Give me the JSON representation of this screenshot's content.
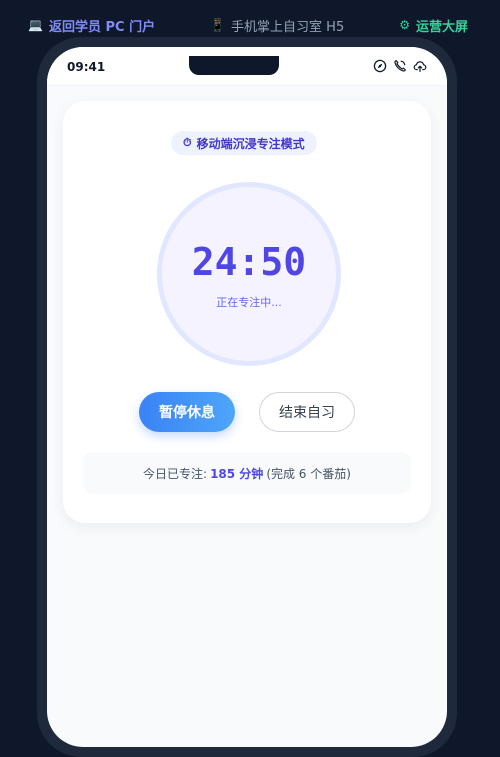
{
  "topnav": {
    "pc_icon": "💻",
    "pc_label": "返回学员 PC 门户",
    "h5_icon": "📱",
    "h5_label": "手机掌上自习室 H5",
    "ops_icon": "⚙",
    "ops_label": "运营大屏"
  },
  "statusbar": {
    "time": "09:41",
    "icons": [
      "compass-icon",
      "phone-icon",
      "cloud-upload-icon"
    ]
  },
  "focus": {
    "mode_icon": "⏱",
    "mode_label": "移动端沉浸专注模式",
    "timer": "24:50",
    "status": "正在专注中..."
  },
  "actions": {
    "pause_label": "暂停休息",
    "end_label": "结束自习"
  },
  "summary": {
    "prefix": "今日已专注:",
    "minutes": "185 分钟",
    "suffix": "(完成 6 个番茄)"
  },
  "colors": {
    "accent": "#4f46e5",
    "primary_button": "#3b82f6",
    "nav_pc": "#818cf8",
    "nav_ops": "#34d399",
    "background": "#0f172a"
  }
}
